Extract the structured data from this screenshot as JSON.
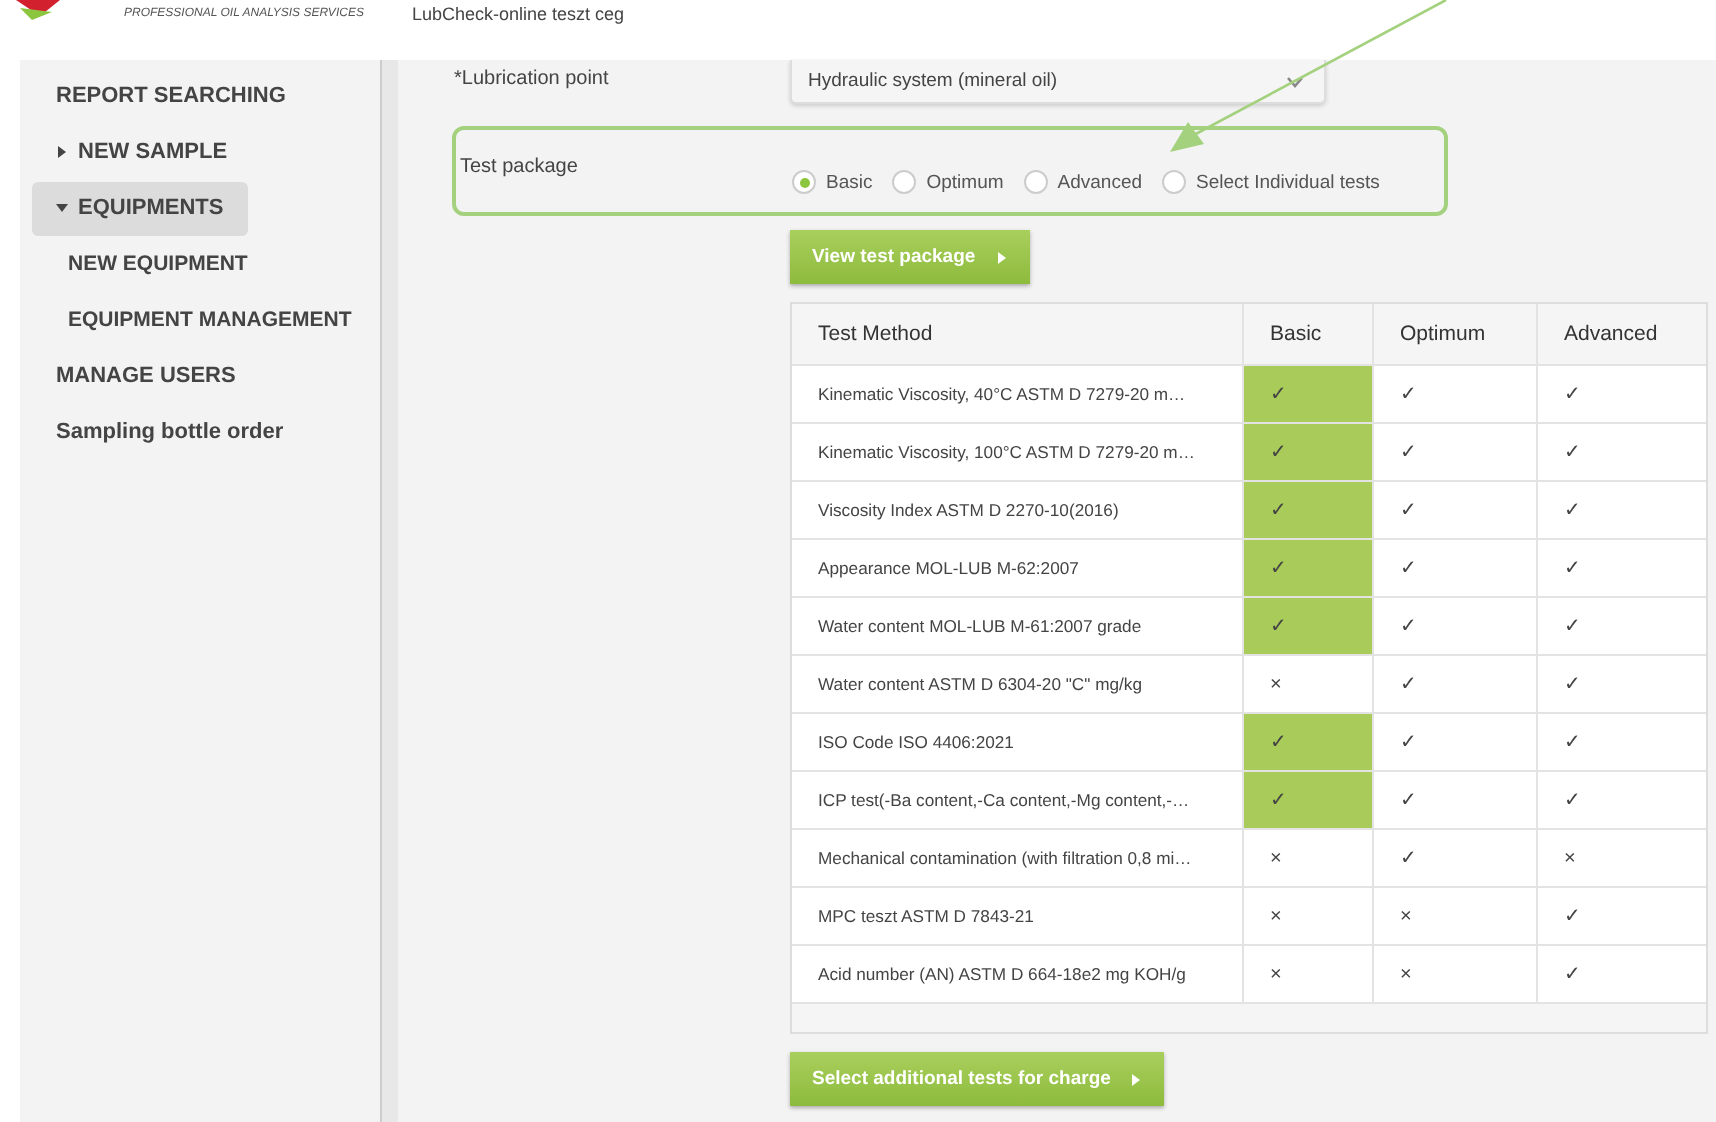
{
  "header": {
    "tagline": "PROFESSIONAL OIL ANALYSIS SERVICES",
    "company": "LubCheck-online teszt ceg"
  },
  "sidebar": {
    "items": [
      {
        "label": "REPORT SEARCHING",
        "selected": false
      },
      {
        "label": "NEW SAMPLE",
        "selected": false,
        "expanded": false
      },
      {
        "label": "EQUIPMENTS",
        "selected": true,
        "expanded": true,
        "children": [
          {
            "label": "NEW EQUIPMENT",
            "selected": false
          },
          {
            "label": "EQUIPMENT MANAGEMENT",
            "selected": false
          }
        ]
      },
      {
        "label": "MANAGE USERS",
        "selected": false
      },
      {
        "label": "Sampling bottle order",
        "selected": false
      }
    ]
  },
  "form": {
    "lubrication_label": "*Lubrication point",
    "lubrication_value": "Hydraulic system (mineral oil)",
    "package_label": "Test package",
    "packages": [
      {
        "label": "Basic",
        "selected": true
      },
      {
        "label": "Optimum",
        "selected": false
      },
      {
        "label": "Advanced",
        "selected": false
      },
      {
        "label": "Select Individual tests",
        "selected": false
      }
    ],
    "view_button": "View test package"
  },
  "table": {
    "columns": [
      "Test Method",
      "Basic",
      "Optimum",
      "Advanced"
    ],
    "rows": [
      {
        "cells": [
          {
            "text": "Kinematic Viscosity, 40°C ASTM D 7279-20 m…",
            "highlighted": false
          },
          {
            "text": "✓",
            "highlighted": true
          },
          {
            "text": "✓",
            "highlighted": false
          },
          {
            "text": "✓",
            "highlighted": false
          }
        ]
      },
      {
        "cells": [
          {
            "text": "Kinematic Viscosity, 100°C ASTM D 7279-20 m…",
            "highlighted": false
          },
          {
            "text": "✓",
            "highlighted": true
          },
          {
            "text": "✓",
            "highlighted": false
          },
          {
            "text": "✓",
            "highlighted": false
          }
        ]
      },
      {
        "cells": [
          {
            "text": "Viscosity Index ASTM D 2270-10(2016)",
            "highlighted": false
          },
          {
            "text": "✓",
            "highlighted": true
          },
          {
            "text": "✓",
            "highlighted": false
          },
          {
            "text": "✓",
            "highlighted": false
          }
        ]
      },
      {
        "cells": [
          {
            "text": "Appearance MOL-LUB M-62:2007",
            "highlighted": false
          },
          {
            "text": "✓",
            "highlighted": true
          },
          {
            "text": "✓",
            "highlighted": false
          },
          {
            "text": "✓",
            "highlighted": false
          }
        ]
      },
      {
        "cells": [
          {
            "text": "Water content MOL-LUB M-61:2007 grade",
            "highlighted": false
          },
          {
            "text": "✓",
            "highlighted": true
          },
          {
            "text": "✓",
            "highlighted": false
          },
          {
            "text": "✓",
            "highlighted": false
          }
        ]
      },
      {
        "cells": [
          {
            "text": "Water content ASTM D 6304-20 \"C\" mg/kg",
            "highlighted": false
          },
          {
            "text": "×",
            "highlighted": false
          },
          {
            "text": "✓",
            "highlighted": false
          },
          {
            "text": "✓",
            "highlighted": false
          }
        ]
      },
      {
        "cells": [
          {
            "text": "ISO Code ISO 4406:2021",
            "highlighted": false
          },
          {
            "text": "✓",
            "highlighted": true
          },
          {
            "text": "✓",
            "highlighted": false
          },
          {
            "text": "✓",
            "highlighted": false
          }
        ]
      },
      {
        "cells": [
          {
            "text": "ICP test(-Ba content,-Ca content,-Mg content,-…",
            "highlighted": false
          },
          {
            "text": "✓",
            "highlighted": true
          },
          {
            "text": "✓",
            "highlighted": false
          },
          {
            "text": "✓",
            "highlighted": false
          }
        ]
      },
      {
        "cells": [
          {
            "text": "Mechanical contamination (with filtration 0,8 mi…",
            "highlighted": false
          },
          {
            "text": "×",
            "highlighted": false
          },
          {
            "text": "✓",
            "highlighted": false
          },
          {
            "text": "×",
            "highlighted": false
          }
        ]
      },
      {
        "cells": [
          {
            "text": "MPC teszt ASTM D 7843-21",
            "highlighted": false
          },
          {
            "text": "×",
            "highlighted": false
          },
          {
            "text": "×",
            "highlighted": false
          },
          {
            "text": "✓",
            "highlighted": false
          }
        ]
      },
      {
        "cells": [
          {
            "text": "Acid number (AN) ASTM D 664-18e2 mg KOH/g",
            "highlighted": false
          },
          {
            "text": "×",
            "highlighted": false
          },
          {
            "text": "×",
            "highlighted": false
          },
          {
            "text": "✓",
            "highlighted": false
          }
        ]
      }
    ]
  },
  "additional_button": "Select additional tests for charge"
}
